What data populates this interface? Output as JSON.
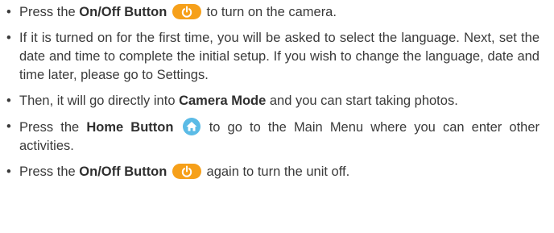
{
  "instructions": {
    "item1": {
      "pre": "Press the ",
      "bold": "On/Off Button",
      "icon": "power-icon",
      "post": " to turn on the camera."
    },
    "item2": {
      "text": "If it is turned on for the first time, you will be asked to select the language. Next, set the date and time to complete the initial setup. If you wish to change the language, date and time later, please go to Settings."
    },
    "item3": {
      "pre": "Then, it will go directly into ",
      "bold": "Camera Mode",
      "post": " and you can start taking photos."
    },
    "item4": {
      "pre": "Press the ",
      "bold": "Home Button",
      "icon": "home-icon",
      "post": " to go to the Main Menu where you can enter other activities."
    },
    "item5": {
      "pre": "Press the ",
      "bold": "On/Off Button",
      "icon": "power-icon",
      "post": " again to turn the unit off."
    }
  },
  "colors": {
    "power_button": "#f6a01a",
    "home_button": "#5bbbe6",
    "text": "#3a3a3a"
  }
}
